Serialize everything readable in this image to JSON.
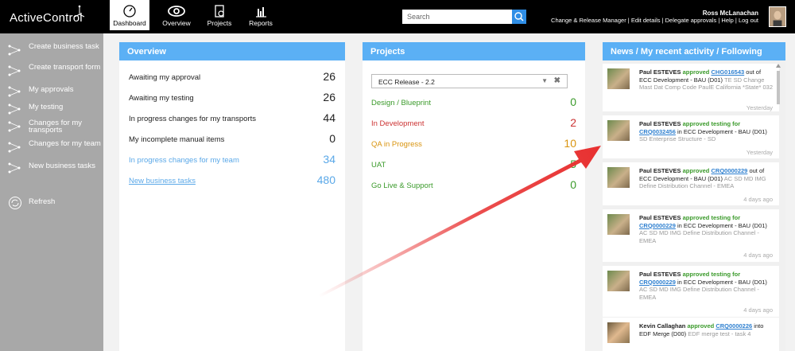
{
  "app": {
    "brand": "ActiveControl"
  },
  "nav": {
    "tabs": [
      {
        "label": "Dashboard",
        "icon": "speedometer-icon"
      },
      {
        "label": "Overview",
        "icon": "eye-icon"
      },
      {
        "label": "Projects",
        "icon": "clipboard-icon"
      },
      {
        "label": "Reports",
        "icon": "bar-chart-icon"
      }
    ],
    "active_tab": "Dashboard"
  },
  "search": {
    "placeholder": "Search"
  },
  "user": {
    "name": "Ross McLanachan",
    "links": [
      "Change & Release Manager",
      "Edit details",
      "Delegate approvals",
      "Help",
      "Log out"
    ]
  },
  "sidebar": {
    "items": [
      {
        "label": "Create business task"
      },
      {
        "label": "Create transport form"
      },
      {
        "label": "My approvals"
      },
      {
        "label": "My testing"
      },
      {
        "label": "Changes for my transports"
      },
      {
        "label": "Changes for my team"
      },
      {
        "label": "New business tasks"
      }
    ],
    "refresh": "Refresh"
  },
  "overview": {
    "title": "Overview",
    "rows": [
      {
        "label": "Awaiting my approval",
        "value": "26"
      },
      {
        "label": "Awaiting my testing",
        "value": "26"
      },
      {
        "label": "In progress changes for my transports",
        "value": "44"
      },
      {
        "label": "My incomplete manual items",
        "value": "0"
      },
      {
        "label": "In progress changes for my team",
        "value": "34"
      },
      {
        "label": "New business tasks",
        "value": "480"
      }
    ]
  },
  "projects": {
    "title": "Projects",
    "selected_release": "ECC Release - 2.2",
    "rows": [
      {
        "label": "Design / Blueprint",
        "value": "0",
        "color": "#3a9a2a"
      },
      {
        "label": "In Development",
        "value": "2",
        "color": "#cc3333"
      },
      {
        "label": "QA in Progress",
        "value": "10",
        "color": "#d9940f"
      },
      {
        "label": "UAT",
        "value": "5",
        "color": "#3a9a2a"
      },
      {
        "label": "Go Live & Support",
        "value": "0",
        "color": "#3a9a2a"
      }
    ]
  },
  "news": {
    "title": "News / My recent activity / Following",
    "items": [
      {
        "who": "Paul ESTEVES",
        "verb": "approved",
        "ref": "CHG016543",
        "pre": "",
        "mid": "out of ECC Development - BAU (D01)",
        "detail": "TE SD Change Mast Dat Comp Code PaulE California *State* 032",
        "time": "Yesterday"
      },
      {
        "who": "Paul ESTEVES",
        "verb": "approved testing",
        "pre": "for",
        "ref": "CRQ0032456",
        "mid": "in ECC Development - BAU (D01)",
        "detail": "SD Enterprise Structure - SD",
        "time": "Yesterday"
      },
      {
        "who": "Paul ESTEVES",
        "verb": "approved",
        "ref": "CRQ0000229",
        "pre": "",
        "mid": "out of ECC Development - BAU (D01)",
        "detail": "AC SD MD IMG Define Distribution Channel - EMEA",
        "time": "4 days ago"
      },
      {
        "who": "Paul ESTEVES",
        "verb": "approved testing",
        "pre": "for",
        "ref": "CRQ0000229",
        "mid": "in ECC Development - BAU (D01)",
        "detail": "AC SD MD IMG Define Distribution Channel - EMEA",
        "time": "4 days ago"
      },
      {
        "who": "Paul ESTEVES",
        "verb": "approved testing",
        "pre": "for",
        "ref": "CRQ0000229",
        "mid": "in ECC Development - BAU (D01)",
        "detail": "AC SD MD IMG Define Distribution Channel - EMEA",
        "time": "4 days ago"
      },
      {
        "who": "Kevin Callaghan",
        "verb": "approved",
        "ref": "CRQ0000226",
        "pre": "",
        "mid": "into EDF Merge (D00)",
        "detail": "EDF merge test - task 4",
        "time": ""
      }
    ]
  },
  "colors": {
    "accent": "#5bb0f5",
    "topbar": "#000000",
    "sidebar": "#a8a8a8",
    "annotation_arrow": "#e83030"
  }
}
